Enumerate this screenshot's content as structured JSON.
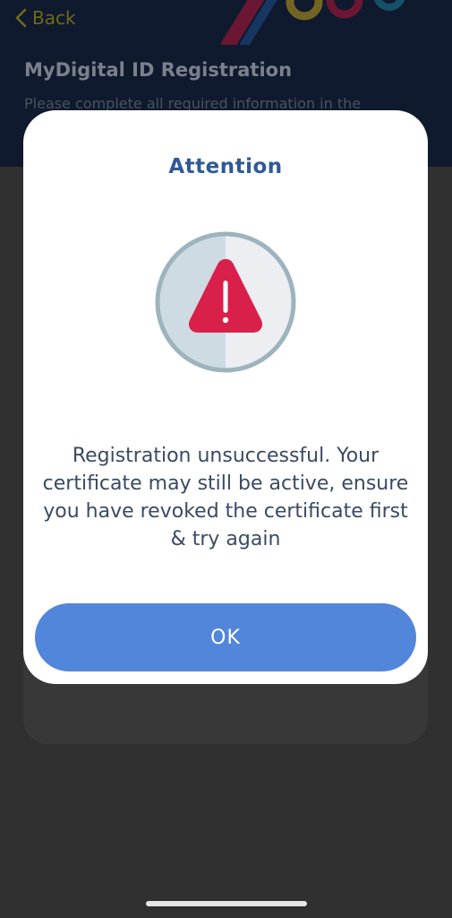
{
  "header": {
    "back_label": "Back",
    "title": "MyDigital ID Registration",
    "subtitle": "Please complete all required information in the"
  },
  "dialog": {
    "title": "Attention",
    "icon": "warning-triangle-icon",
    "message": "Registration unsuccessful. Your certificate may still be active, ensure you have revoked the certificate first & try again",
    "ok_label": "OK"
  },
  "colors": {
    "accent": "#5286da",
    "title": "#2f5a96",
    "warning": "#d9204a",
    "overlay": "#303030"
  }
}
